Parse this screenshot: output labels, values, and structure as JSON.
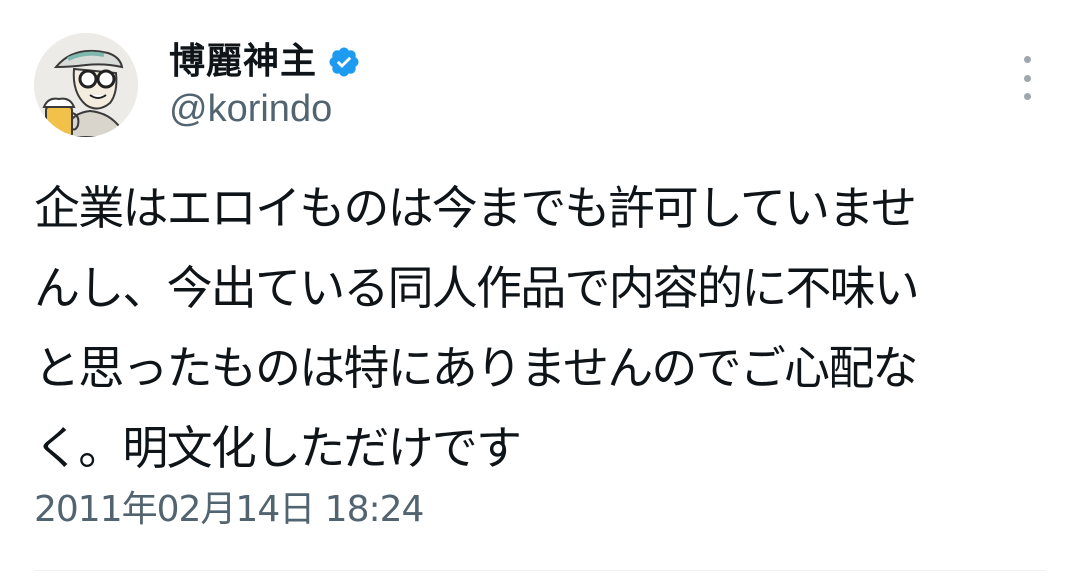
{
  "tweet": {
    "author": {
      "display_name": "博麗神主",
      "handle": "@korindo",
      "verified": true
    },
    "text_lines": [
      "企業はエロイものは今までも許可していませ",
      "んし、今出ている同人作品で内容的に不味い",
      "と思ったものは特にありませんのでご心配な",
      "く。明文化しただけです"
    ],
    "timestamp": "2011年02月14日 18:24"
  },
  "icons": {
    "verified": "verified-badge-icon",
    "more": "more-vertical-icon"
  },
  "colors": {
    "verified_blue": "#1d9bf0",
    "text_primary": "#0f1419",
    "text_secondary": "#536471"
  }
}
